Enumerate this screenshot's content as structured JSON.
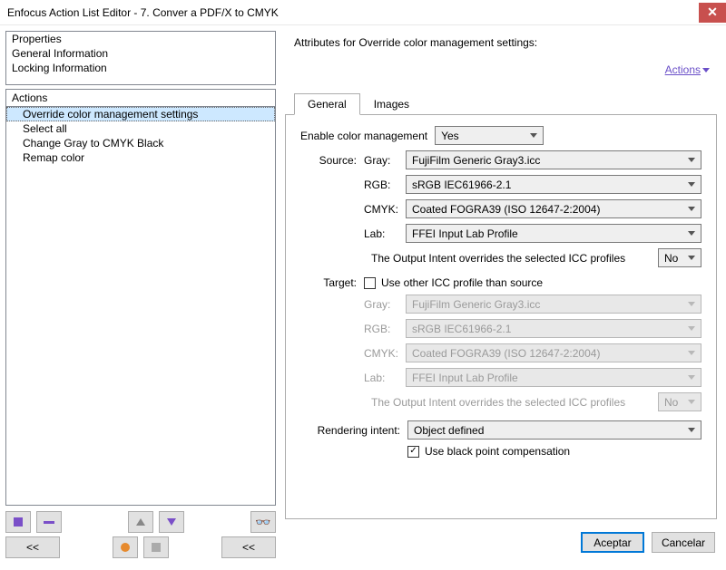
{
  "window": {
    "title": "Enfocus Action List Editor - 7. Conver a PDF/X to CMYK"
  },
  "leftPanel": {
    "properties": [
      "Properties",
      "General Information",
      "Locking Information"
    ],
    "actionsHeader": "Actions",
    "actions": [
      "Override color management settings",
      "Select all",
      "Change Gray to CMYK Black",
      "Remap color"
    ],
    "nav": {
      "prev": "<<",
      "next": "<<"
    }
  },
  "rightPanel": {
    "headerText": "Attributes for Override color management settings:",
    "actionsLink": "Actions",
    "tabs": {
      "general": "General",
      "images": "Images"
    },
    "enableLabel": "Enable color management",
    "enableValue": "Yes",
    "sourceLabel": "Source:",
    "targetLabel": "Target:",
    "renderingLabel": "Rendering intent:",
    "fields": {
      "grayLabel": "Gray:",
      "grayValue": "FujiFilm Generic Gray3.icc",
      "rgbLabel": "RGB:",
      "rgbValue": "sRGB IEC61966-2.1",
      "cmykLabel": "CMYK:",
      "cmykValue": "Coated FOGRA39 (ISO 12647-2:2004)",
      "labLabel": "Lab:",
      "labValue": "FFEI Input Lab Profile"
    },
    "overrideNote": "The Output Intent overrides the selected ICC profiles",
    "overrideValue": "No",
    "useOtherCheckbox": "Use other ICC profile than source",
    "renderingValue": "Object defined",
    "blackPointCheckbox": "Use black point compensation"
  },
  "footer": {
    "accept": "Aceptar",
    "cancel": "Cancelar"
  }
}
